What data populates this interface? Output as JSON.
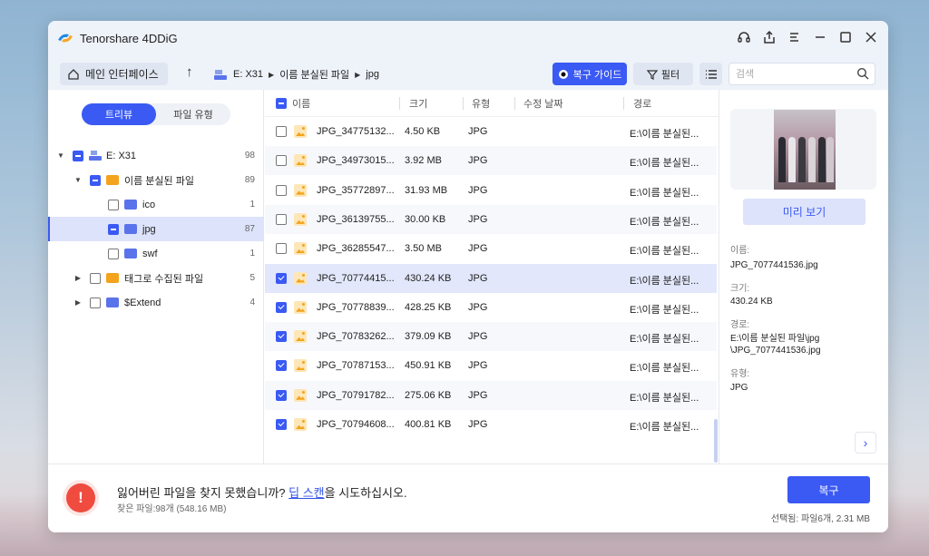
{
  "app": {
    "title": "Tenorshare 4DDiG"
  },
  "toolbar": {
    "home_label": "메인 인터페이스",
    "breadcrumb": [
      "E: X31",
      "이름 분실된 파일",
      "jpg"
    ],
    "recover_guide_label": "복구 가이드",
    "filter_label": "필터",
    "search_placeholder": "검색"
  },
  "sidebar": {
    "tabs": [
      "트리뷰",
      "파일 유형"
    ],
    "active_tab": "트리뷰",
    "tree": [
      {
        "label": "E: X31",
        "count": "98"
      },
      {
        "label": "이름 분실된 파일",
        "count": "89"
      },
      {
        "label": "ico",
        "count": "1"
      },
      {
        "label": "jpg",
        "count": "87"
      },
      {
        "label": "swf",
        "count": "1"
      },
      {
        "label": "태그로 수집된 파일",
        "count": "5"
      },
      {
        "label": "$Extend",
        "count": "4"
      }
    ]
  },
  "file_list": {
    "columns": [
      "이름",
      "크기",
      "유형",
      "수정 날짜",
      "경로"
    ],
    "rows": [
      {
        "name": "JPG_34775132...",
        "size": "4.50 KB",
        "type": "JPG",
        "modified": "",
        "path": "E:\\이름 분실된...",
        "checked": false
      },
      {
        "name": "JPG_34973015...",
        "size": "3.92 MB",
        "type": "JPG",
        "modified": "",
        "path": "E:\\이름 분실된...",
        "checked": false
      },
      {
        "name": "JPG_35772897...",
        "size": "31.93 MB",
        "type": "JPG",
        "modified": "",
        "path": "E:\\이름 분실된...",
        "checked": false
      },
      {
        "name": "JPG_36139755...",
        "size": "30.00 KB",
        "type": "JPG",
        "modified": "",
        "path": "E:\\이름 분실된...",
        "checked": false
      },
      {
        "name": "JPG_36285547...",
        "size": "3.50 MB",
        "type": "JPG",
        "modified": "",
        "path": "E:\\이름 분실된...",
        "checked": false
      },
      {
        "name": "JPG_70774415...",
        "size": "430.24 KB",
        "type": "JPG",
        "modified": "",
        "path": "E:\\이름 분실된...",
        "checked": true
      },
      {
        "name": "JPG_70778839...",
        "size": "428.25 KB",
        "type": "JPG",
        "modified": "",
        "path": "E:\\이름 분실된...",
        "checked": true
      },
      {
        "name": "JPG_70783262...",
        "size": "379.09 KB",
        "type": "JPG",
        "modified": "",
        "path": "E:\\이름 분실된...",
        "checked": true
      },
      {
        "name": "JPG_70787153...",
        "size": "450.91 KB",
        "type": "JPG",
        "modified": "",
        "path": "E:\\이름 분실된...",
        "checked": true
      },
      {
        "name": "JPG_70791782...",
        "size": "275.06 KB",
        "type": "JPG",
        "modified": "",
        "path": "E:\\이름 분실된...",
        "checked": true
      },
      {
        "name": "JPG_70794608...",
        "size": "400.81 KB",
        "type": "JPG",
        "modified": "",
        "path": "E:\\이름 분실된...",
        "checked": true
      }
    ]
  },
  "preview": {
    "button_label": "미리 보기",
    "name_label": "이름:",
    "name_value": "JPG_7077441536.jpg",
    "size_label": "크기:",
    "size_value": "430.24 KB",
    "path_label": "경로:",
    "path_value_1": "E:\\이름 분실된 파일\\jpg",
    "path_value_2": "\\JPG_7077441536.jpg",
    "type_label": "유형:",
    "type_value": "JPG"
  },
  "footer": {
    "message_prefix": "잃어버린 파일을 찾지 못했습니까? ",
    "link_text": "딥 스캔",
    "message_suffix": "을 시도하십시오.",
    "found_text": "찾은 파일:98개 (548.16 MB)",
    "recover_label": "복구",
    "selected_text": "선택됨: 파일6개, 2.31 MB"
  },
  "colors": {
    "accent": "#3a5af3",
    "warning": "#ef4b3f",
    "folder_blue": "#5a73ea",
    "folder_orange": "#f3a31c"
  }
}
